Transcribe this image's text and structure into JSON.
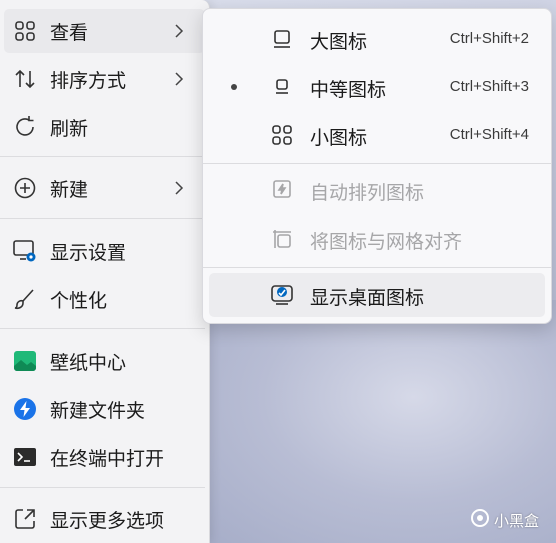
{
  "main_menu": {
    "items": [
      {
        "label": "查看",
        "icon": "grid-icon"
      },
      {
        "label": "排序方式",
        "icon": "sort-icon"
      },
      {
        "label": "刷新",
        "icon": "refresh-icon"
      },
      {
        "label": "新建",
        "icon": "plus-circle-icon"
      },
      {
        "label": "显示设置",
        "icon": "display-settings-icon"
      },
      {
        "label": "个性化",
        "icon": "brush-icon"
      },
      {
        "label": "壁纸中心",
        "icon": "wallpaper-icon"
      },
      {
        "label": "新建文件夹",
        "icon": "lightning-icon"
      },
      {
        "label": "在终端中打开",
        "icon": "terminal-icon"
      },
      {
        "label": "显示更多选项",
        "icon": "expand-icon"
      }
    ]
  },
  "view_submenu": {
    "items": [
      {
        "label": "大图标",
        "shortcut": "Ctrl+Shift+2",
        "icon": "large-icons-icon"
      },
      {
        "label": "中等图标",
        "shortcut": "Ctrl+Shift+3",
        "icon": "medium-icons-icon",
        "selected": true
      },
      {
        "label": "小图标",
        "shortcut": "Ctrl+Shift+4",
        "icon": "small-icons-icon"
      },
      {
        "label": "自动排列图标",
        "icon": "auto-arrange-icon",
        "disabled": true
      },
      {
        "label": "将图标与网格对齐",
        "icon": "align-grid-icon",
        "disabled": true
      },
      {
        "label": "显示桌面图标",
        "icon": "show-desktop-icons-icon"
      }
    ]
  },
  "watermark": {
    "text": "小黑盒"
  },
  "colors": {
    "accent": "#0067c0",
    "menu_bg": "#f3f3f5",
    "disabled_text": "#a6a6a8"
  }
}
